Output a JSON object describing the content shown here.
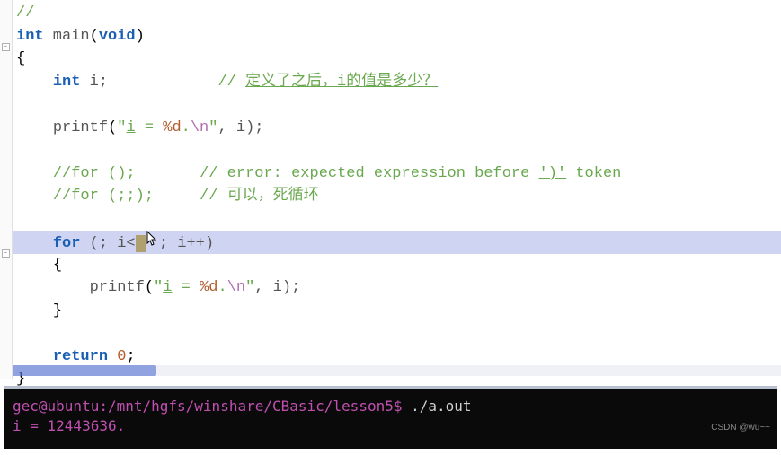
{
  "code": {
    "l0_cmt": "//",
    "l1_int": "int",
    "l1_main": " main",
    "l1_paren_o": "(",
    "l1_void": "void",
    "l1_paren_c": ")",
    "l2_brace": "{",
    "l3_indent": "    ",
    "l3_int": "int",
    "l3_var": " i;",
    "l3_space": "            ",
    "l3_slashes": "// ",
    "l3_cmt": "定义了之后，i的值是多少？",
    "l4_empty": "",
    "l5_indent": "    ",
    "l5_printf": "printf",
    "l5_po": "(",
    "l5_q1": "\"",
    "l5_i_under": "i",
    "l5_str_eq": " = ",
    "l5_fmt": "%d",
    "l5_dot": ".",
    "l5_esc": "\\n",
    "l5_q2": "\"",
    "l5_comma": ", i);",
    "l6_empty": "",
    "l7_indent": "    ",
    "l7_cmt_a": "//for ();",
    "l7_space": "       ",
    "l7_slashes": "// ",
    "l7_err": "error: expected expression before ",
    "l7_tok": "')'",
    "l7_token": " token",
    "l8_indent": "    ",
    "l8_cmt_a": "//for (;;);",
    "l8_space": "     ",
    "l8_slashes": "// ",
    "l8_body": "可以，死循环",
    "l9_empty": "",
    "l10_indent": "    ",
    "l10_for": "for",
    "l10_po": " (; ",
    "l10_cond": "i<",
    "l10_sel": " ",
    "l10_rest": "; i++)",
    "l11_indent": "    ",
    "l11_brace": "{",
    "l12_indent": "        ",
    "l12_printf": "printf",
    "l12_po": "(",
    "l12_q1": "\"",
    "l12_i_under": "i",
    "l12_str_eq": " = ",
    "l12_fmt": "%d",
    "l12_dot": ".",
    "l12_esc": "\\n",
    "l12_q2": "\"",
    "l12_comma": ", i);",
    "l13_indent": "    ",
    "l13_brace": "}",
    "l14_empty": "",
    "l15_indent": "    ",
    "l15_return": "return",
    "l15_sp": " ",
    "l15_zero": "0",
    "l15_semi": ";",
    "l16_brace": "}"
  },
  "terminal": {
    "prompt": "gec@ubuntu:/mnt/hgfs/winshare/CBasic/lesson5$ ",
    "cmd": "./a.out",
    "output": "i = 12443636."
  },
  "watermark": "CSDN @wu~~"
}
